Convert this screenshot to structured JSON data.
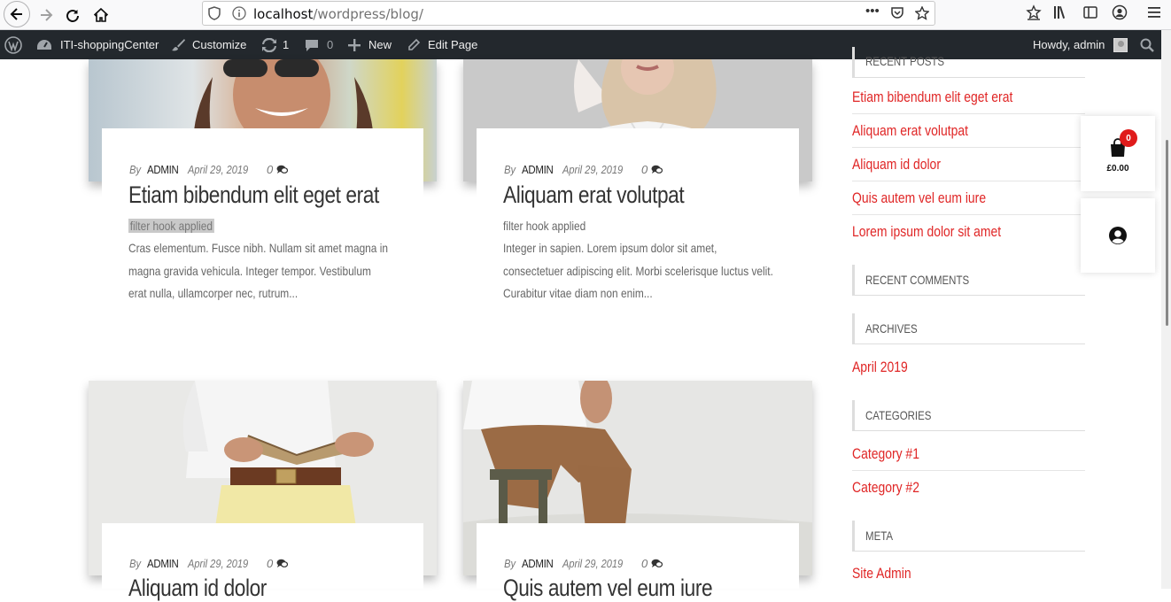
{
  "browser": {
    "url_host": "localhost",
    "url_path": "/wordpress/blog/",
    "more": "•••"
  },
  "adminbar": {
    "site_name": "ITI-shoppingCenter",
    "customize": "Customize",
    "updates_count": "1",
    "comments_count": "0",
    "new_label": "New",
    "edit_page": "Edit Page",
    "howdy": "Howdy, admin"
  },
  "posts": [
    {
      "by": "By",
      "author": "ADMIN",
      "date": "April 29, 2019",
      "comments": "0",
      "title": "Etiam bibendum elit eget erat",
      "hook": "filter hook applied",
      "excerpt": "Cras elementum. Fusce nibh. Nullam sit amet magna in magna gravida vehicula. Integer tempor. Vestibulum erat nulla, ullamcorper nec, rutrum..."
    },
    {
      "by": "By",
      "author": "ADMIN",
      "date": "April 29, 2019",
      "comments": "0",
      "title": "Aliquam erat volutpat",
      "hook": "filter hook applied",
      "excerpt": "Integer in sapien. Lorem ipsum dolor sit amet, consectetuer adipiscing elit. Morbi scelerisque luctus velit. Curabitur vitae diam non enim..."
    },
    {
      "by": "By",
      "author": "ADMIN",
      "date": "April 29, 2019",
      "comments": "0",
      "title": "Aliquam id dolor"
    },
    {
      "by": "By",
      "author": "ADMIN",
      "date": "April 29, 2019",
      "comments": "0",
      "title": "Quis autem vel eum iure"
    }
  ],
  "sidebar": {
    "recent_posts_title": "RECENT POSTS",
    "recent_posts": [
      "Etiam bibendum elit eget erat",
      "Aliquam erat volutpat",
      "Aliquam id dolor",
      "Quis autem vel eum iure",
      "Lorem ipsum dolor sit amet"
    ],
    "recent_comments_title": "RECENT COMMENTS",
    "archives_title": "ARCHIVES",
    "archives": [
      "April 2019"
    ],
    "categories_title": "CATEGORIES",
    "categories": [
      "Category #1",
      "Category #2"
    ],
    "meta_title": "META",
    "meta": [
      "Site Admin"
    ]
  },
  "cart": {
    "count": "0",
    "total": "£0.00"
  },
  "colors": {
    "link": "#e02626",
    "adminbar": "#23282d",
    "badge": "#e01b1b"
  }
}
